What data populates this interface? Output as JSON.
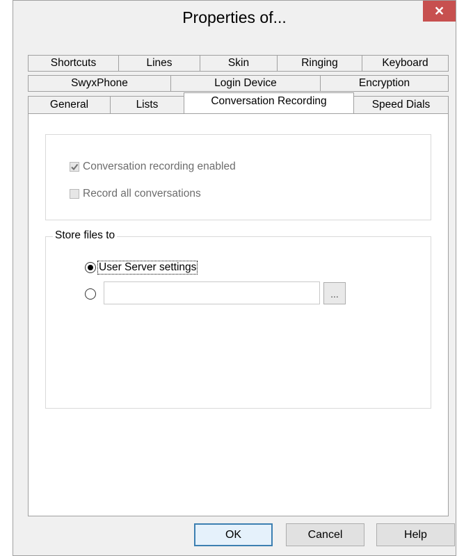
{
  "window": {
    "title": "Properties of...",
    "close_glyph": "✕"
  },
  "tabs": {
    "row1": [
      "Shortcuts",
      "Lines",
      "Skin",
      "Ringing",
      "Keyboard"
    ],
    "row2": [
      "SwyxPhone",
      "Login Device",
      "Encryption"
    ],
    "row3": [
      "General",
      "Lists",
      "Conversation Recording",
      "Speed Dials"
    ],
    "active": "Conversation Recording"
  },
  "recording": {
    "enabled_label": "Conversation recording enabled",
    "enabled_checked": true,
    "record_all_label": "Record all conversations",
    "record_all_checked": false
  },
  "store": {
    "caption": "Store files to",
    "option_server_label": "User Server settings",
    "selected": "server",
    "path_value": "",
    "browse_label": "..."
  },
  "buttons": {
    "ok": "OK",
    "cancel": "Cancel",
    "help": "Help"
  },
  "colors": {
    "close": "#c7504f",
    "accent": "#3c7fb1"
  }
}
